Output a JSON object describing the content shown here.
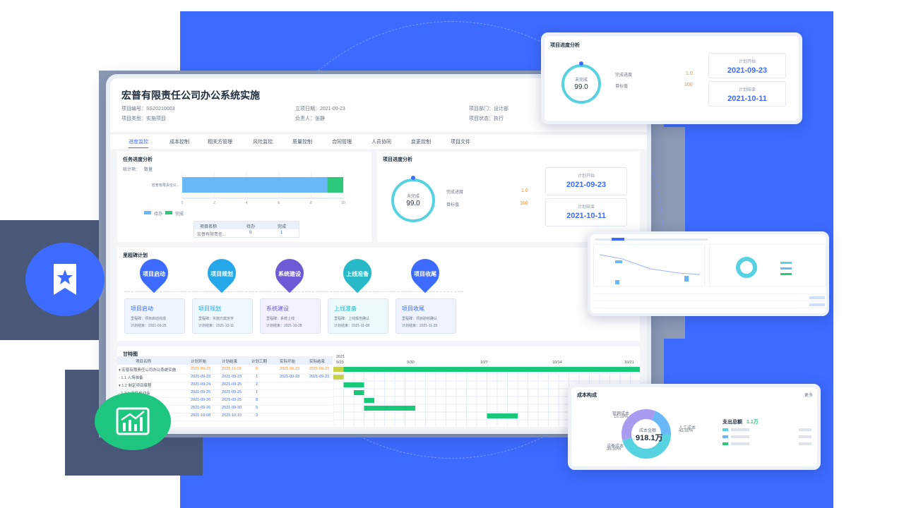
{
  "project": {
    "title": "宏普有限责任公司办公系统实施",
    "code": "项目编号：SS20210003",
    "type": "项目类型：实施项目",
    "date": "立项日期：2021-09-23",
    "owner": "负责人：张静",
    "dept": "项目部门：设计部",
    "status": "项目状态：执行"
  },
  "tabs": [
    "进度监控",
    "成本控制",
    "相关方管理",
    "风险监控",
    "质量控制",
    "合同管理",
    "人员协同",
    "变更控制",
    "项目文件"
  ],
  "task_panel": {
    "title": "任务进度分析",
    "stat_label": "统计项：",
    "stat_value": "数量",
    "row_label": "宏普有限责任公...",
    "legend_pending": "待办",
    "legend_done": "完成",
    "table_head": [
      "项目名称",
      "待办",
      "完成"
    ],
    "table_row": [
      "宏普有限责任...",
      "9",
      "1"
    ]
  },
  "chart_data": {
    "type": "bar",
    "categories": [
      "宏普有限责任公..."
    ],
    "series": [
      {
        "name": "待办",
        "values": [
          9
        ]
      },
      {
        "name": "完成",
        "values": [
          1
        ]
      }
    ],
    "xlim": [
      0,
      10
    ],
    "xticks": [
      "0",
      "2",
      "4",
      "6",
      "8",
      "10"
    ],
    "stacked": true,
    "orientation": "horizontal",
    "colors": [
      "#6ab8f7",
      "#2ec87a"
    ]
  },
  "progress_panel": {
    "title": "项目进度分析",
    "gauge_label": "未完成",
    "gauge_value": "99.0",
    "done_label": "完成进度",
    "done_value": "1.0",
    "target_label": "目标值",
    "target_value": "100",
    "plan_start_label": "计划开始",
    "plan_start": "2021-09-23",
    "plan_end_label": "计划结束",
    "plan_end": "2021-10-11"
  },
  "milestones": {
    "title": "里程碑计划",
    "items": [
      {
        "pin": "项目启动",
        "name": "项目启动",
        "deliv": "里程碑：项目启动完成",
        "end": "计划结束：2021-09-25"
      },
      {
        "pin": "项目规划",
        "name": "项目规划",
        "deliv": "里程碑：实施方案定字",
        "end": "计划结束：2021-10-11"
      },
      {
        "pin": "系统建设",
        "name": "系统建设",
        "deliv": "里程碑：系统上线",
        "end": "计划结束：2021-10-28"
      },
      {
        "pin": "上线准备",
        "name": "上线准备",
        "deliv": "里程碑：上线报告确认",
        "end": "计划结束：2021-11-08"
      },
      {
        "pin": "项目收尾",
        "name": "项目收尾",
        "deliv": "里程碑：项目验收确认",
        "end": "计划结束：2021-11-29"
      }
    ]
  },
  "gantt": {
    "title": "甘特图",
    "head": [
      "项目名称",
      "计划开始",
      "计划结束",
      "计划工期",
      "实际开始",
      "实际结束"
    ],
    "year": "2021",
    "dates": [
      "9/23",
      "9/30",
      "10/7",
      "10/14",
      "10/21"
    ],
    "rows": [
      {
        "name": "▾ 宏普有限责任公司办公系统实施",
        "ps": "2021-09-23",
        "pe": "2021-11-29",
        "d": "6",
        "as": "2021-09-23",
        "ae": "2021-09-23"
      },
      {
        "name": "  - 1.1 入场准备",
        "ps": "2021-09-23",
        "pe": "2021-09-23",
        "d": "1",
        "as": "2021-09-23",
        "ae": "2021-09-23"
      },
      {
        "name": "  ▾ 1.2 制定项目章程",
        "ps": "2021-09-24",
        "pe": "2021-09-25",
        "d": "2",
        "as": "",
        "ae": ""
      },
      {
        "name": "    - 1.2.1 召开启动会",
        "ps": "2021-09-25",
        "pe": "2021-09-25",
        "d": "1",
        "as": "",
        "ae": ""
      },
      {
        "name": "",
        "ps": "2021-09-26",
        "pe": "2021-09-25",
        "d": "8",
        "as": "",
        "ae": ""
      },
      {
        "name": "",
        "ps": "2021-09-26",
        "pe": "2021-09-30",
        "d": "5",
        "as": "",
        "ae": ""
      },
      {
        "name": "",
        "ps": "2021-10-08",
        "pe": "2021-10-10",
        "d": "3",
        "as": "",
        "ae": ""
      }
    ]
  },
  "float_progress": {
    "title": "项目进度分析",
    "gauge_label": "未完成",
    "gauge_value": "99.0",
    "done_label": "完成进度",
    "done_value": "1.0",
    "target_label": "目标值",
    "target_value": "100",
    "plan_start_label": "计划开始",
    "plan_start": "2021-09-23",
    "plan_end_label": "计划结束",
    "plan_end": "2021-10-11"
  },
  "float_cost": {
    "title": "成本构成",
    "more": "更多",
    "center_label": "成本金额",
    "center_value": "918.1万",
    "seg_manage": "管理成本",
    "seg_manage_pct": "15.19%",
    "seg_labor": "人工成本",
    "seg_labor_pct": "45.80%",
    "seg_equip": "设备成本",
    "seg_equip_pct": "35.30%",
    "spend_label": "支出总额",
    "spend_value": "1.1万"
  },
  "colors": {
    "brand": "#3d6bff",
    "accent_orange": "#ff8a1f",
    "accent_green": "#2ec87a",
    "accent_cyan": "#56d2e0"
  }
}
